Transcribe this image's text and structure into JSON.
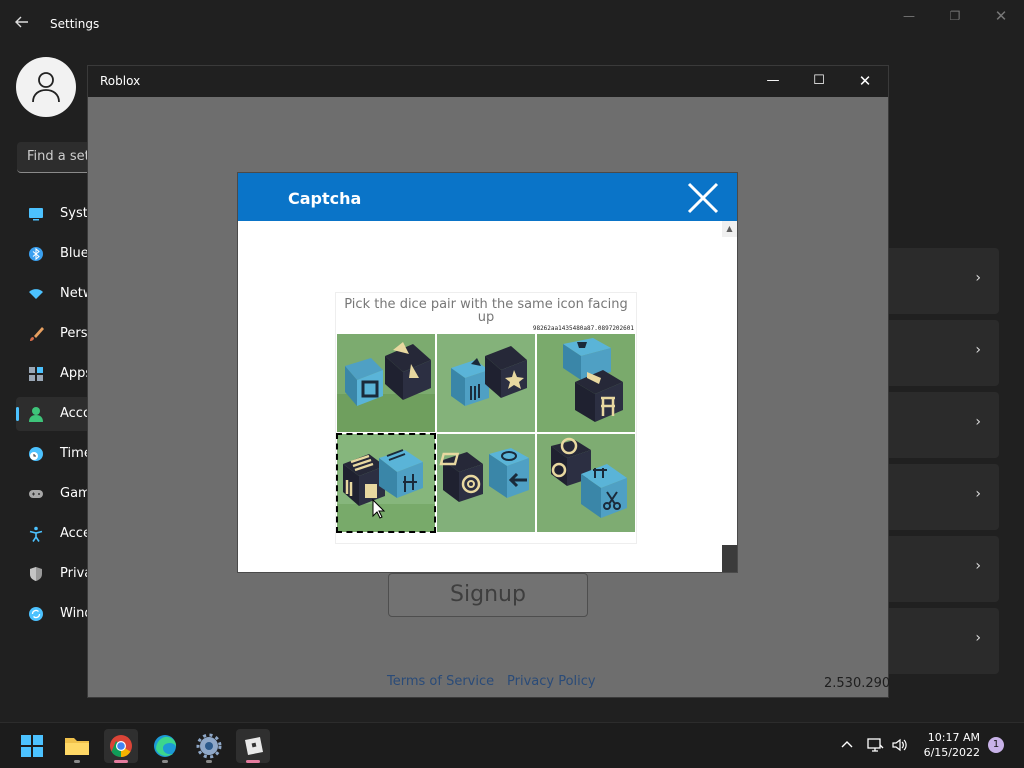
{
  "settings": {
    "title": "Settings",
    "search_placeholder": "Find a setting",
    "nav": [
      {
        "label": "System",
        "icon": "monitor-icon",
        "color": "#4cc2ff"
      },
      {
        "label": "Bluetooth & devices",
        "icon": "bluetooth-icon",
        "color": "#3aa0f0"
      },
      {
        "label": "Network & internet",
        "icon": "wifi-icon",
        "color": "#4cc2ff"
      },
      {
        "label": "Personalization",
        "icon": "brush-icon",
        "color": "#e8a060"
      },
      {
        "label": "Apps",
        "icon": "apps-icon",
        "color": "#9aa7b5"
      },
      {
        "label": "Accounts",
        "icon": "person-icon",
        "color": "#3ec47a"
      },
      {
        "label": "Time & language",
        "icon": "clock-globe-icon",
        "color": "#4cc2ff"
      },
      {
        "label": "Gaming",
        "icon": "gamepad-icon",
        "color": "#a7a7a7"
      },
      {
        "label": "Accessibility",
        "icon": "accessibility-icon",
        "color": "#4cc2ff"
      },
      {
        "label": "Privacy & security",
        "icon": "shield-icon",
        "color": "#9a9a9a"
      },
      {
        "label": "Windows Update",
        "icon": "refresh-icon",
        "color": "#4cc2ff"
      }
    ],
    "active_index": 5
  },
  "roblox": {
    "title": "Roblox",
    "signup_label": "Signup",
    "terms_label": "Terms of Service",
    "privacy_label": "Privacy Policy",
    "version": "2.530.290",
    "link_color": "#2a4b78"
  },
  "captcha": {
    "title": "Captcha",
    "header_color": "#0a74c8",
    "instruction": "Pick the dice pair with the same icon facing up",
    "hash": "98262aa1435480a87.0897202601",
    "tiles": [
      {
        "icons": [
          "stop-icon",
          "sailboat-icon"
        ],
        "selected": false
      },
      {
        "icons": [
          "sailboat-icon",
          "star-icon"
        ],
        "selected": false
      },
      {
        "icons": [
          "trophy-icon",
          "fork-icon"
        ],
        "selected": false
      },
      {
        "icons": [
          "fork-icon",
          "fork-icon"
        ],
        "selected": true
      },
      {
        "icons": [
          "spiral-icon",
          "arrow-left-icon"
        ],
        "selected": false
      },
      {
        "icons": [
          "spiral-icon",
          "scissors-icon"
        ],
        "selected": false
      }
    ]
  },
  "taskbar": {
    "apps": [
      "windows-start-icon",
      "file-explorer-icon",
      "chrome-icon",
      "edge-icon",
      "settings-icon",
      "roblox-icon"
    ],
    "active_app": "roblox-icon",
    "time": "10:17 AM",
    "date": "6/15/2022",
    "notification_count": "1"
  }
}
